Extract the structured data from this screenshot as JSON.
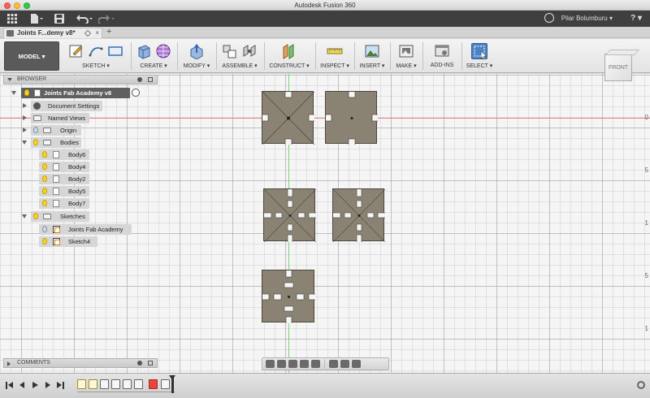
{
  "window": {
    "title": "Autodesk Fusion 360"
  },
  "quick_access": {
    "user_name": "Pilar Bolumburu ▾",
    "help_label": "?"
  },
  "tab": {
    "title": "Joints F...demy v8*",
    "close": "×",
    "add": "+"
  },
  "ribbon": {
    "workspace": "MODEL ▾",
    "groups": [
      {
        "label": "SKETCH ▾"
      },
      {
        "label": "CREATE ▾"
      },
      {
        "label": "MODIFY ▾"
      },
      {
        "label": "ASSEMBLE ▾"
      },
      {
        "label": "CONSTRUCT ▾"
      },
      {
        "label": "INSPECT ▾"
      },
      {
        "label": "INSERT ▾"
      },
      {
        "label": "MAKE ▾"
      },
      {
        "label": "ADD-INS"
      },
      {
        "label": "SELECT ▾"
      }
    ]
  },
  "browser": {
    "title": "BROWSER",
    "root": "Joints Fab Academy v8",
    "items": [
      {
        "label": "Document Settings"
      },
      {
        "label": "Named Views"
      },
      {
        "label": "Origin"
      },
      {
        "label": "Bodies"
      },
      {
        "label": "Body6"
      },
      {
        "label": "Body4"
      },
      {
        "label": "Body2"
      },
      {
        "label": "Body5"
      },
      {
        "label": "Body7"
      },
      {
        "label": "Sketches"
      },
      {
        "label": "Joints Fab Academy"
      },
      {
        "label": "Sketch4"
      }
    ]
  },
  "comments": {
    "title": "COMMENTS"
  },
  "viewcube": {
    "face": "FRONT"
  },
  "canvas": {
    "ruler_labels": [
      "0",
      "5",
      "1",
      "5",
      "1"
    ]
  }
}
